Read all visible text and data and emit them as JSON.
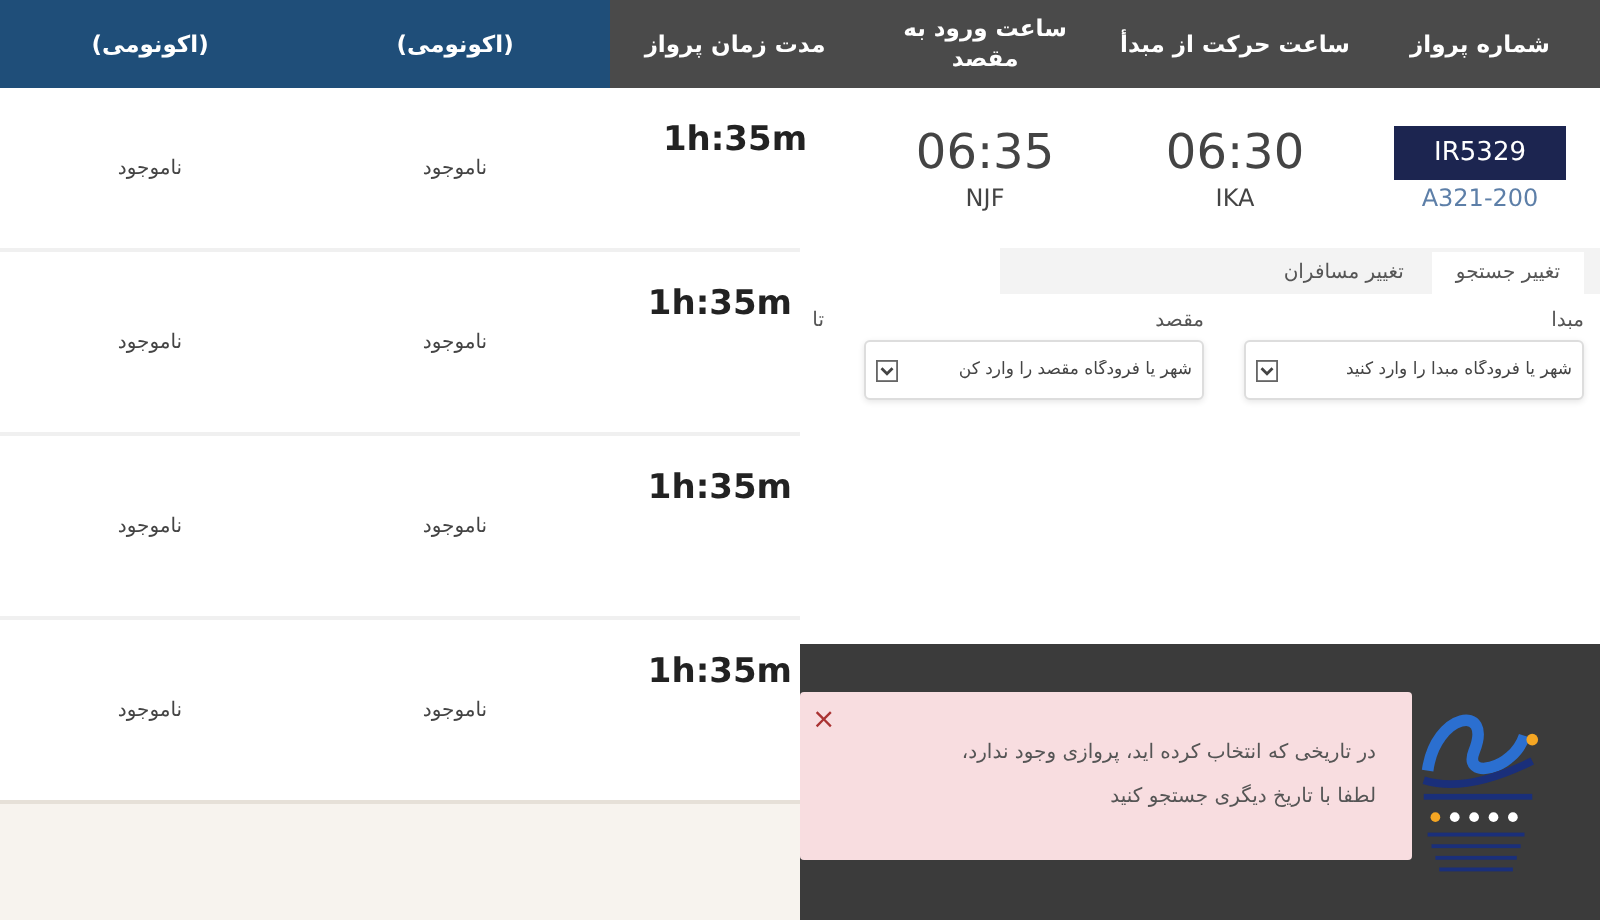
{
  "header": {
    "columns": [
      {
        "label": "شماره پرواز",
        "kind": "plain"
      },
      {
        "label": "ساعت حرکت از مبدأ",
        "kind": "plain"
      },
      {
        "label": "ساعت ورود به مقصد",
        "kind": "plain"
      },
      {
        "label": "مدت زمان پرواز",
        "kind": "plain"
      },
      {
        "label": "(اکونومی)",
        "kind": "fare"
      },
      {
        "label": "(اکونومی)",
        "kind": "fare"
      }
    ]
  },
  "first_row": {
    "flight_number": "IR5329",
    "aircraft": "A321-200",
    "departure_time": "06:30",
    "origin": "IKA",
    "arrival_time": "06:35",
    "destination": "NJF",
    "duration": "1h:35m",
    "fares": [
      "ناموجود",
      "ناموجود"
    ]
  },
  "rows": [
    {
      "duration": "1h:35m",
      "fares": [
        "ناموجود",
        "ناموجود"
      ]
    },
    {
      "duration": "1h:35m",
      "fares": [
        "ناموجود",
        "ناموجود"
      ]
    },
    {
      "duration": "1h:35m",
      "fares": [
        "ناموجود",
        "ناموجود"
      ]
    }
  ],
  "search_panel": {
    "tabs": [
      {
        "label": "تغییر جستجو",
        "selected": true
      },
      {
        "label": "تغییر مسافران",
        "selected": false
      }
    ],
    "fields": [
      {
        "label": "مبدا",
        "placeholder": "شهر یا فرودگاه مبدا را وارد کنید"
      },
      {
        "label": "مقصد",
        "placeholder": "شهر یا فرودگاه مقصد را وارد کن"
      }
    ],
    "next_label": "تا"
  },
  "alert": {
    "close": "×",
    "message": "در تاریخی که انتخاب کرده اید، پروازی وجود ندارد، لطفا با تاریخ دیگری جستجو کنید"
  }
}
